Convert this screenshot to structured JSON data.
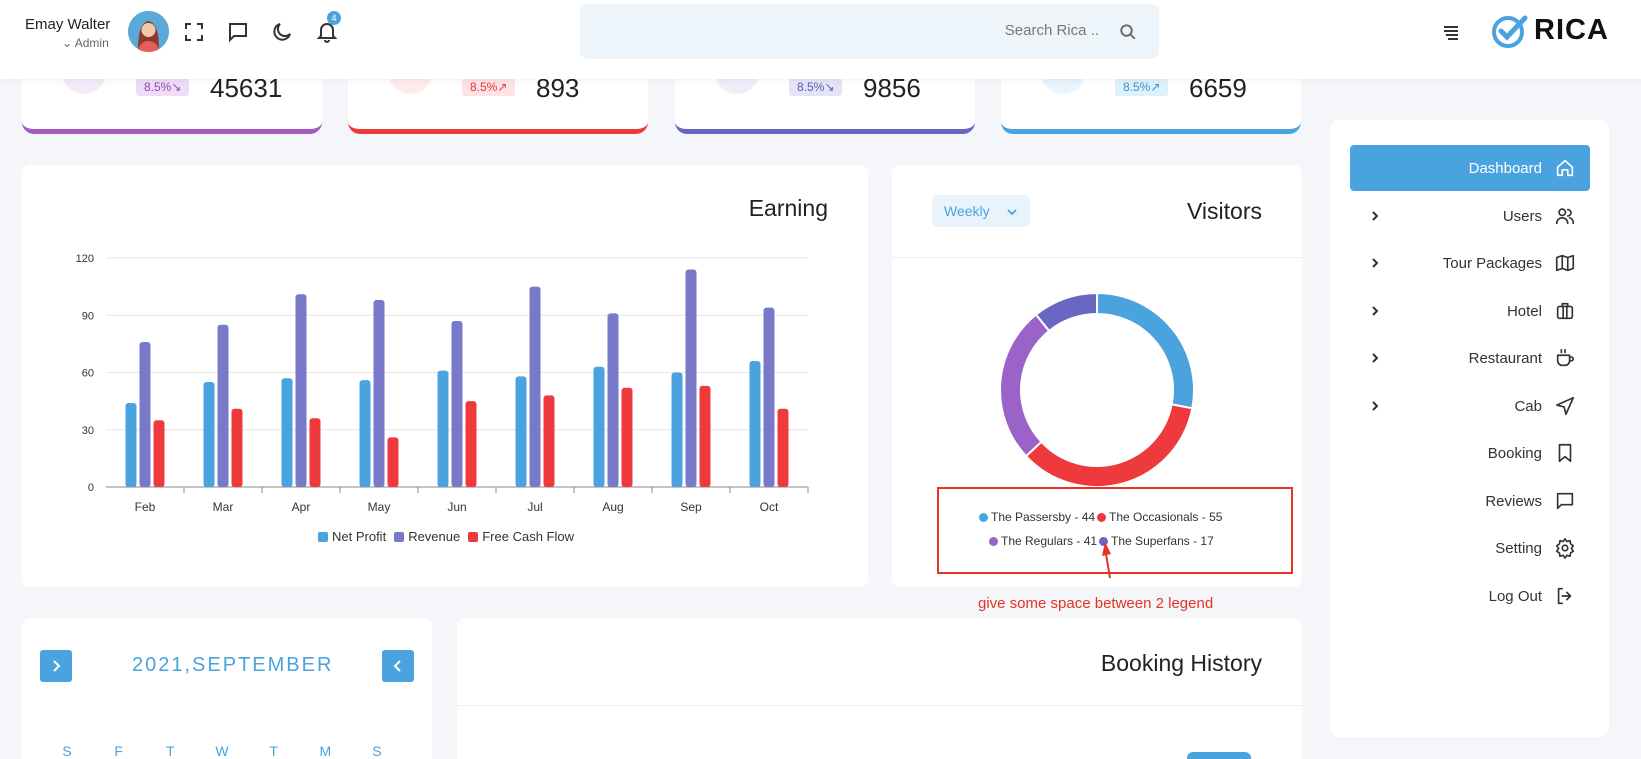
{
  "header": {
    "user_name": "Emay Walter",
    "user_role": "Admin",
    "notification_count": "4",
    "search_placeholder": "Search Rica ..",
    "logo_text": "RICA"
  },
  "stats": [
    {
      "change": "8.5%",
      "trend": "down",
      "value": "45631",
      "color": "#a45bc1",
      "badge_bg": "#efdcf7",
      "badge_fg": "#8e4bb0",
      "circle_bg": "#f3ebf9"
    },
    {
      "change": "8.5%",
      "trend": "up",
      "value": "893",
      "color": "#ef3a3d",
      "badge_bg": "#fde3e3",
      "badge_fg": "#e53935",
      "circle_bg": "#fdecec"
    },
    {
      "change": "8.5%",
      "trend": "down",
      "value": "9856",
      "color": "#6a67c4",
      "badge_bg": "#e5e4f7",
      "badge_fg": "#5b59b8",
      "circle_bg": "#eeeef9"
    },
    {
      "change": "8.5%",
      "trend": "up",
      "value": "6659",
      "color": "#4aa3df",
      "badge_bg": "#def0fa",
      "badge_fg": "#3a93cf",
      "circle_bg": "#e9f4fb"
    }
  ],
  "earning": {
    "title": "Earning"
  },
  "chart_data": [
    {
      "type": "bar",
      "title": "Earning",
      "categories": [
        "Feb",
        "Mar",
        "Apr",
        "May",
        "Jun",
        "Jul",
        "Aug",
        "Sep",
        "Oct"
      ],
      "ylim": [
        0,
        120
      ],
      "yticks": [
        0,
        30,
        60,
        90,
        120
      ],
      "grid": true,
      "legend_position": "bottom",
      "series": [
        {
          "name": "Net Profit",
          "color": "#4aa3df",
          "values": [
            44,
            55,
            57,
            56,
            61,
            58,
            63,
            60,
            66
          ]
        },
        {
          "name": "Revenue",
          "color": "#7879c9",
          "values": [
            76,
            85,
            101,
            98,
            87,
            105,
            91,
            114,
            94
          ]
        },
        {
          "name": "Free Cash Flow",
          "color": "#ef3a3d",
          "values": [
            35,
            41,
            36,
            26,
            45,
            48,
            52,
            53,
            41
          ]
        }
      ]
    },
    {
      "type": "pie",
      "title": "Visitors",
      "donut": true,
      "legend_position": "bottom",
      "slices": [
        {
          "name": "The Passersby",
          "value": 44,
          "color": "#4aa3df",
          "label": "The Passersby - 44"
        },
        {
          "name": "The Occasionals",
          "value": 55,
          "color": "#ef3a3d",
          "label": "The Occasionals - 55"
        },
        {
          "name": "The Regulars",
          "value": 41,
          "color": "#9b63c8",
          "label": "The Regulars - 41"
        },
        {
          "name": "The Superfans",
          "value": 17,
          "color": "#6a67c4",
          "label": "The Superfans - 17"
        }
      ]
    }
  ],
  "visitors": {
    "title": "Visitors",
    "period": "Weekly"
  },
  "annotation": {
    "text": "give some space between 2 legend"
  },
  "sidebar": {
    "items": [
      {
        "label": "Dashboard",
        "icon": "home-icon",
        "active": true,
        "expandable": false
      },
      {
        "label": "Users",
        "icon": "users-icon",
        "active": false,
        "expandable": true
      },
      {
        "label": "Tour Packages",
        "icon": "map-icon",
        "active": false,
        "expandable": true
      },
      {
        "label": "Hotel",
        "icon": "briefcase-icon",
        "active": false,
        "expandable": true
      },
      {
        "label": "Restaurant",
        "icon": "coffee-icon",
        "active": false,
        "expandable": true
      },
      {
        "label": "Cab",
        "icon": "navigation-icon",
        "active": false,
        "expandable": true
      },
      {
        "label": "Booking",
        "icon": "bookmark-icon",
        "active": false,
        "expandable": false
      },
      {
        "label": "Reviews",
        "icon": "message-icon",
        "active": false,
        "expandable": false
      },
      {
        "label": "Setting",
        "icon": "gear-icon",
        "active": false,
        "expandable": false
      },
      {
        "label": "Log Out",
        "icon": "logout-icon",
        "active": false,
        "expandable": false
      }
    ]
  },
  "calendar": {
    "title": "2021,SEPTEMBER",
    "days": [
      "S",
      "F",
      "T",
      "W",
      "T",
      "M",
      "S"
    ]
  },
  "booking": {
    "title": "Booking History"
  },
  "colors": {
    "accent": "#4aa3df",
    "annotation": "#e53324"
  }
}
